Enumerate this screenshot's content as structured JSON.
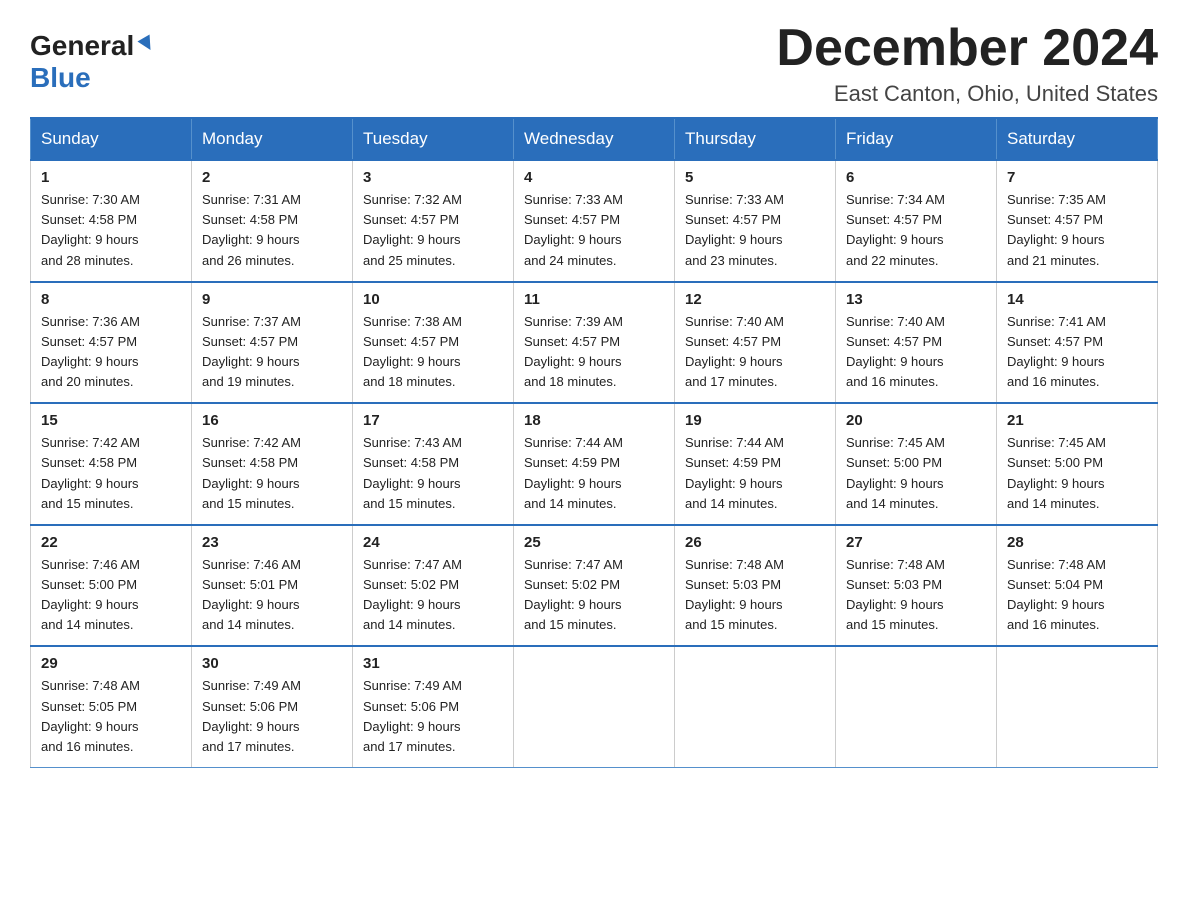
{
  "header": {
    "logo_general": "General",
    "logo_blue": "Blue",
    "month_title": "December 2024",
    "location": "East Canton, Ohio, United States"
  },
  "days_of_week": [
    "Sunday",
    "Monday",
    "Tuesday",
    "Wednesday",
    "Thursday",
    "Friday",
    "Saturday"
  ],
  "weeks": [
    [
      {
        "day": "1",
        "sunrise": "7:30 AM",
        "sunset": "4:58 PM",
        "daylight": "9 hours and 28 minutes."
      },
      {
        "day": "2",
        "sunrise": "7:31 AM",
        "sunset": "4:58 PM",
        "daylight": "9 hours and 26 minutes."
      },
      {
        "day": "3",
        "sunrise": "7:32 AM",
        "sunset": "4:57 PM",
        "daylight": "9 hours and 25 minutes."
      },
      {
        "day": "4",
        "sunrise": "7:33 AM",
        "sunset": "4:57 PM",
        "daylight": "9 hours and 24 minutes."
      },
      {
        "day": "5",
        "sunrise": "7:33 AM",
        "sunset": "4:57 PM",
        "daylight": "9 hours and 23 minutes."
      },
      {
        "day": "6",
        "sunrise": "7:34 AM",
        "sunset": "4:57 PM",
        "daylight": "9 hours and 22 minutes."
      },
      {
        "day": "7",
        "sunrise": "7:35 AM",
        "sunset": "4:57 PM",
        "daylight": "9 hours and 21 minutes."
      }
    ],
    [
      {
        "day": "8",
        "sunrise": "7:36 AM",
        "sunset": "4:57 PM",
        "daylight": "9 hours and 20 minutes."
      },
      {
        "day": "9",
        "sunrise": "7:37 AM",
        "sunset": "4:57 PM",
        "daylight": "9 hours and 19 minutes."
      },
      {
        "day": "10",
        "sunrise": "7:38 AM",
        "sunset": "4:57 PM",
        "daylight": "9 hours and 18 minutes."
      },
      {
        "day": "11",
        "sunrise": "7:39 AM",
        "sunset": "4:57 PM",
        "daylight": "9 hours and 18 minutes."
      },
      {
        "day": "12",
        "sunrise": "7:40 AM",
        "sunset": "4:57 PM",
        "daylight": "9 hours and 17 minutes."
      },
      {
        "day": "13",
        "sunrise": "7:40 AM",
        "sunset": "4:57 PM",
        "daylight": "9 hours and 16 minutes."
      },
      {
        "day": "14",
        "sunrise": "7:41 AM",
        "sunset": "4:57 PM",
        "daylight": "9 hours and 16 minutes."
      }
    ],
    [
      {
        "day": "15",
        "sunrise": "7:42 AM",
        "sunset": "4:58 PM",
        "daylight": "9 hours and 15 minutes."
      },
      {
        "day": "16",
        "sunrise": "7:42 AM",
        "sunset": "4:58 PM",
        "daylight": "9 hours and 15 minutes."
      },
      {
        "day": "17",
        "sunrise": "7:43 AM",
        "sunset": "4:58 PM",
        "daylight": "9 hours and 15 minutes."
      },
      {
        "day": "18",
        "sunrise": "7:44 AM",
        "sunset": "4:59 PM",
        "daylight": "9 hours and 14 minutes."
      },
      {
        "day": "19",
        "sunrise": "7:44 AM",
        "sunset": "4:59 PM",
        "daylight": "9 hours and 14 minutes."
      },
      {
        "day": "20",
        "sunrise": "7:45 AM",
        "sunset": "5:00 PM",
        "daylight": "9 hours and 14 minutes."
      },
      {
        "day": "21",
        "sunrise": "7:45 AM",
        "sunset": "5:00 PM",
        "daylight": "9 hours and 14 minutes."
      }
    ],
    [
      {
        "day": "22",
        "sunrise": "7:46 AM",
        "sunset": "5:00 PM",
        "daylight": "9 hours and 14 minutes."
      },
      {
        "day": "23",
        "sunrise": "7:46 AM",
        "sunset": "5:01 PM",
        "daylight": "9 hours and 14 minutes."
      },
      {
        "day": "24",
        "sunrise": "7:47 AM",
        "sunset": "5:02 PM",
        "daylight": "9 hours and 14 minutes."
      },
      {
        "day": "25",
        "sunrise": "7:47 AM",
        "sunset": "5:02 PM",
        "daylight": "9 hours and 15 minutes."
      },
      {
        "day": "26",
        "sunrise": "7:48 AM",
        "sunset": "5:03 PM",
        "daylight": "9 hours and 15 minutes."
      },
      {
        "day": "27",
        "sunrise": "7:48 AM",
        "sunset": "5:03 PM",
        "daylight": "9 hours and 15 minutes."
      },
      {
        "day": "28",
        "sunrise": "7:48 AM",
        "sunset": "5:04 PM",
        "daylight": "9 hours and 16 minutes."
      }
    ],
    [
      {
        "day": "29",
        "sunrise": "7:48 AM",
        "sunset": "5:05 PM",
        "daylight": "9 hours and 16 minutes."
      },
      {
        "day": "30",
        "sunrise": "7:49 AM",
        "sunset": "5:06 PM",
        "daylight": "9 hours and 17 minutes."
      },
      {
        "day": "31",
        "sunrise": "7:49 AM",
        "sunset": "5:06 PM",
        "daylight": "9 hours and 17 minutes."
      },
      null,
      null,
      null,
      null
    ]
  ],
  "labels": {
    "sunrise": "Sunrise:",
    "sunset": "Sunset:",
    "daylight": "Daylight:"
  }
}
